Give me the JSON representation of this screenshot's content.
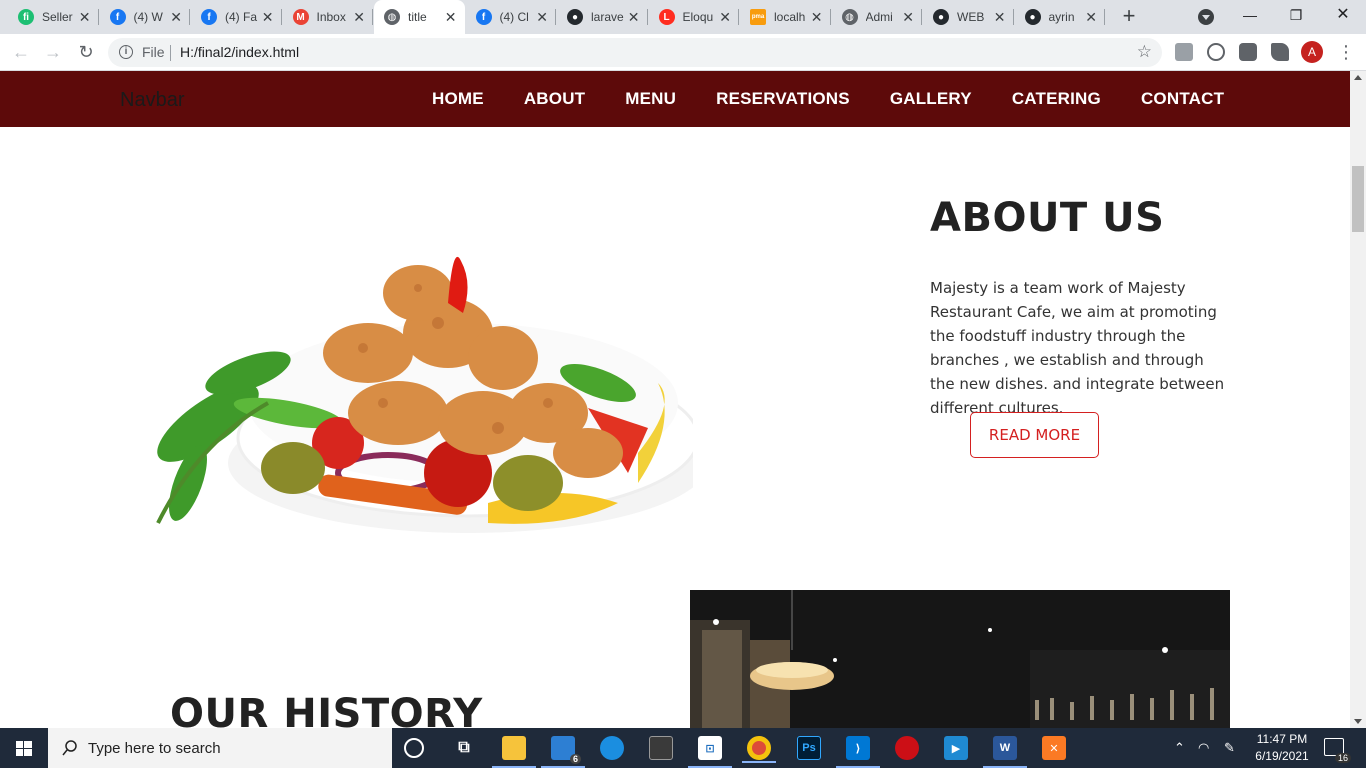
{
  "browser": {
    "tabs": [
      {
        "title": "Seller",
        "favicon": "fiverr-icon",
        "color": "#1dbf73",
        "glyph": "fi"
      },
      {
        "title": "(4) W",
        "favicon": "facebook-icon",
        "color": "#1877f2",
        "glyph": "f"
      },
      {
        "title": "(4) Fa",
        "favicon": "facebook-icon",
        "color": "#1877f2",
        "glyph": "f"
      },
      {
        "title": "Inbox",
        "favicon": "gmail-icon",
        "color": "#ea4335",
        "glyph": "M"
      },
      {
        "title": "title",
        "favicon": "globe-icon",
        "color": "#5f6368",
        "glyph": "◍",
        "active": true
      },
      {
        "title": "(4) Cl",
        "favicon": "facebook-icon",
        "color": "#1877f2",
        "glyph": "f"
      },
      {
        "title": "larave",
        "favicon": "github-icon",
        "color": "#24292e",
        "glyph": "●"
      },
      {
        "title": "Eloqu",
        "favicon": "laravel-icon",
        "color": "#ff2d20",
        "glyph": "L"
      },
      {
        "title": "localh",
        "favicon": "phpmyadmin-icon",
        "color": "#f89c0e",
        "glyph": "pma"
      },
      {
        "title": "Admi",
        "favicon": "globe-icon",
        "color": "#5f6368",
        "glyph": "◍"
      },
      {
        "title": "WEB",
        "favicon": "github-icon",
        "color": "#24292e",
        "glyph": "●"
      },
      {
        "title": "ayrin",
        "favicon": "github-icon",
        "color": "#24292e",
        "glyph": "●"
      }
    ],
    "address": {
      "scheme_label": "File",
      "url": "H:/final2/index.html"
    },
    "profile_initial": "A"
  },
  "site": {
    "brand": "Navbar",
    "nav": [
      "HOME",
      "ABOUT",
      "MENU",
      "RESERVATIONS",
      "GALLERY",
      "CATERING",
      "CONTACT"
    ],
    "about": {
      "title": "ABOUT US",
      "text": "Majesty is a team work of Majesty Restaurant Cafe, we aim at promoting the foodstuff industry through the branches , we establish and through the new dishes. and integrate between different cultures.",
      "button": "READ MORE"
    },
    "history": {
      "title": "OUR HISTORY"
    },
    "colors": {
      "navbar": "#5d0a0a",
      "accent": "#d42020"
    }
  },
  "taskbar": {
    "search_placeholder": "Type here to search",
    "time": "11:47 PM",
    "date": "6/19/2021",
    "mail_badge": "6",
    "notification_badge": "16"
  }
}
